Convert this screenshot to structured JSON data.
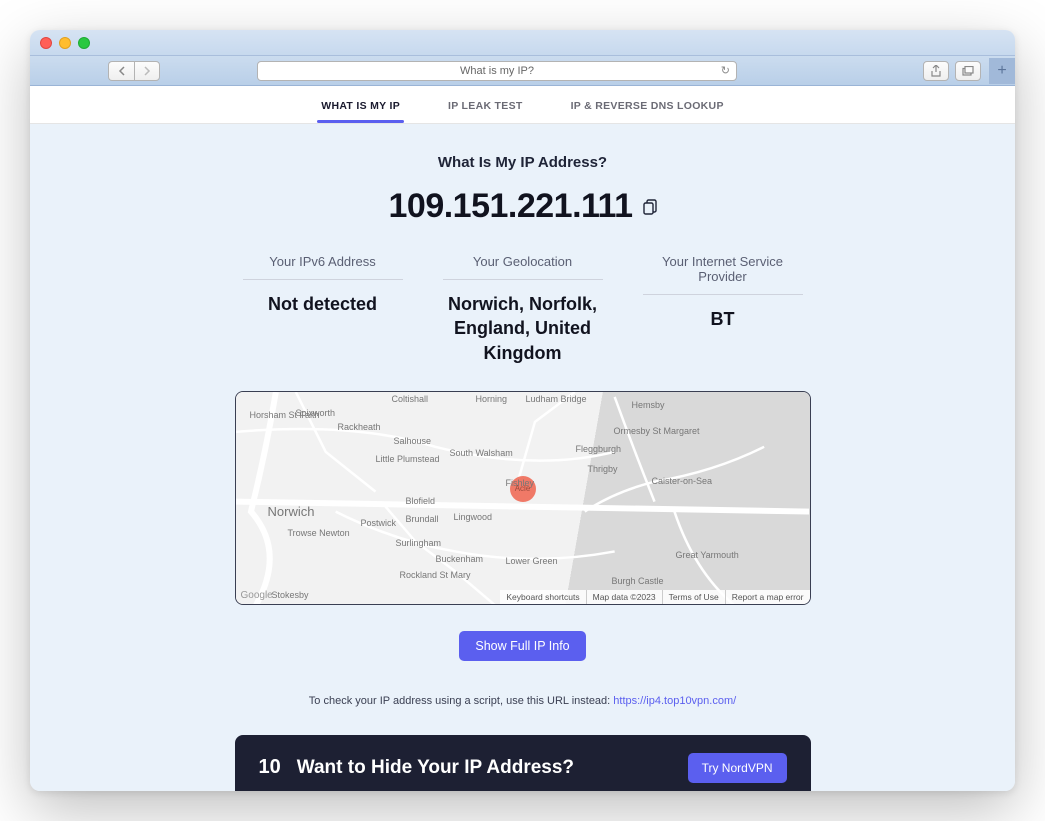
{
  "browser": {
    "address": "What is my IP?"
  },
  "tabs": {
    "whatismyip": "WHAT IS MY IP",
    "ipleak": "IP LEAK TEST",
    "dnslookup": "IP & REVERSE DNS LOOKUP"
  },
  "main": {
    "title": "What Is My IP Address?",
    "ip": "109.151.221.111",
    "ipv6_label": "Your IPv6 Address",
    "ipv6_value": "Not detected",
    "geo_label": "Your Geolocation",
    "geo_value": "Norwich, Norfolk, England, United Kingdom",
    "isp_label": "Your Internet Service Provider",
    "isp_value": "BT",
    "show_full": "Show Full IP Info",
    "script_note": "To check your IP address using a script, use this URL instead: ",
    "script_url": "https://ip4.top10vpn.com/"
  },
  "map": {
    "pin_label": "Acle",
    "places": {
      "norwich": "Norwich",
      "horshamstfaith": "Horsham St Faith",
      "spixworth": "Spixworth",
      "rackheath": "Rackheath",
      "salhouse": "Salhouse",
      "littleplumstead": "Little Plumstead",
      "southwalsham": "South Walsham",
      "fishley": "Fishley",
      "blofield": "Blofield",
      "brundall": "Brundall",
      "postwick": "Postwick",
      "lingwood": "Lingwood",
      "surlingham": "Surlingham",
      "buckenham": "Buckenham",
      "rocklandstmary": "Rockland St Mary",
      "lowergreen": "Lower Green",
      "trowsenewton": "Trowse Newton",
      "hemsby": "Hemsby",
      "ormesbystmargaret": "Ormesby St Margaret",
      "fleggburgh": "Fleggburgh",
      "thrigby": "Thrigby",
      "caisteronsea": "Caister-on-Sea",
      "greatyarmouth": "Great Yarmouth",
      "burghcastle": "Burgh Castle",
      "coltishall": "Coltishall",
      "horning": "Horning",
      "ludhambridge": "Ludham Bridge",
      "stokesby": "Stokesby"
    },
    "footer": {
      "keyboard": "Keyboard shortcuts",
      "mapdata": "Map data ©2023",
      "terms": "Terms of Use",
      "report": "Report a map error"
    },
    "google": "Google"
  },
  "banner": {
    "logo": "10",
    "title": "Want to Hide Your IP Address?",
    "cta": "Try NordVPN"
  }
}
